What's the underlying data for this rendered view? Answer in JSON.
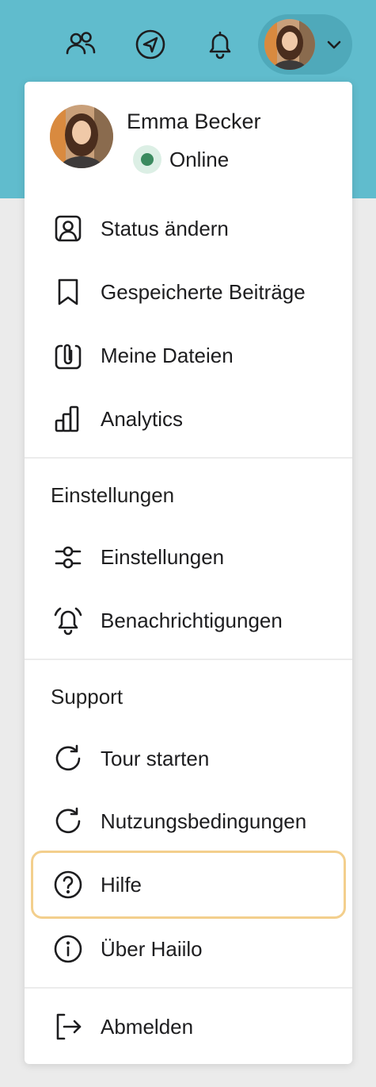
{
  "user": {
    "name": "Emma Becker",
    "status": "Online"
  },
  "colors": {
    "topbar": "#60bccd",
    "online": "#3b8a5f",
    "highlight_border": "#f3cf8d"
  },
  "topbar_icons": [
    "people-icon",
    "compass-icon",
    "bell-icon"
  ],
  "menu": {
    "primary": [
      {
        "label": "Status ändern",
        "icon": "person-frame-icon"
      },
      {
        "label": "Gespeicherte Beiträge",
        "icon": "bookmark-icon"
      },
      {
        "label": "Meine Dateien",
        "icon": "paperclip-icon"
      },
      {
        "label": "Analytics",
        "icon": "bar-chart-icon"
      }
    ],
    "settings_title": "Einstellungen",
    "settings": [
      {
        "label": "Einstellungen",
        "icon": "sliders-icon"
      },
      {
        "label": "Benachrichtigungen",
        "icon": "bell-ring-icon"
      }
    ],
    "support_title": "Support",
    "support": [
      {
        "label": "Tour starten",
        "icon": "refresh-icon"
      },
      {
        "label": "Nutzungsbedingungen",
        "icon": "refresh-icon"
      },
      {
        "label": "Hilfe",
        "icon": "question-circle-icon"
      },
      {
        "label": "Über Haiilo",
        "icon": "info-circle-icon"
      }
    ],
    "logout": {
      "label": "Abmelden",
      "icon": "logout-icon"
    }
  }
}
